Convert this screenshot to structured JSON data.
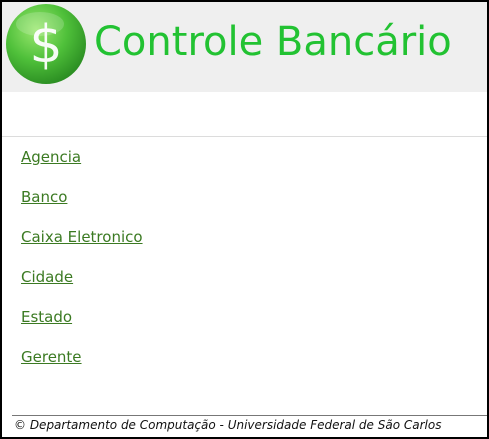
{
  "header": {
    "logo_icon": "dollar-coin-icon",
    "title": "Controle Bancário",
    "title_color": "#22c232"
  },
  "menu": {
    "items": [
      {
        "label": "Agencia"
      },
      {
        "label": "Banco"
      },
      {
        "label": "Caixa Eletronico"
      },
      {
        "label": "Cidade"
      },
      {
        "label": "Estado"
      },
      {
        "label": "Gerente"
      }
    ],
    "link_color": "#3b7a22"
  },
  "footer": {
    "text": "© Departamento de Computação - Universidade Federal de São Carlos"
  }
}
